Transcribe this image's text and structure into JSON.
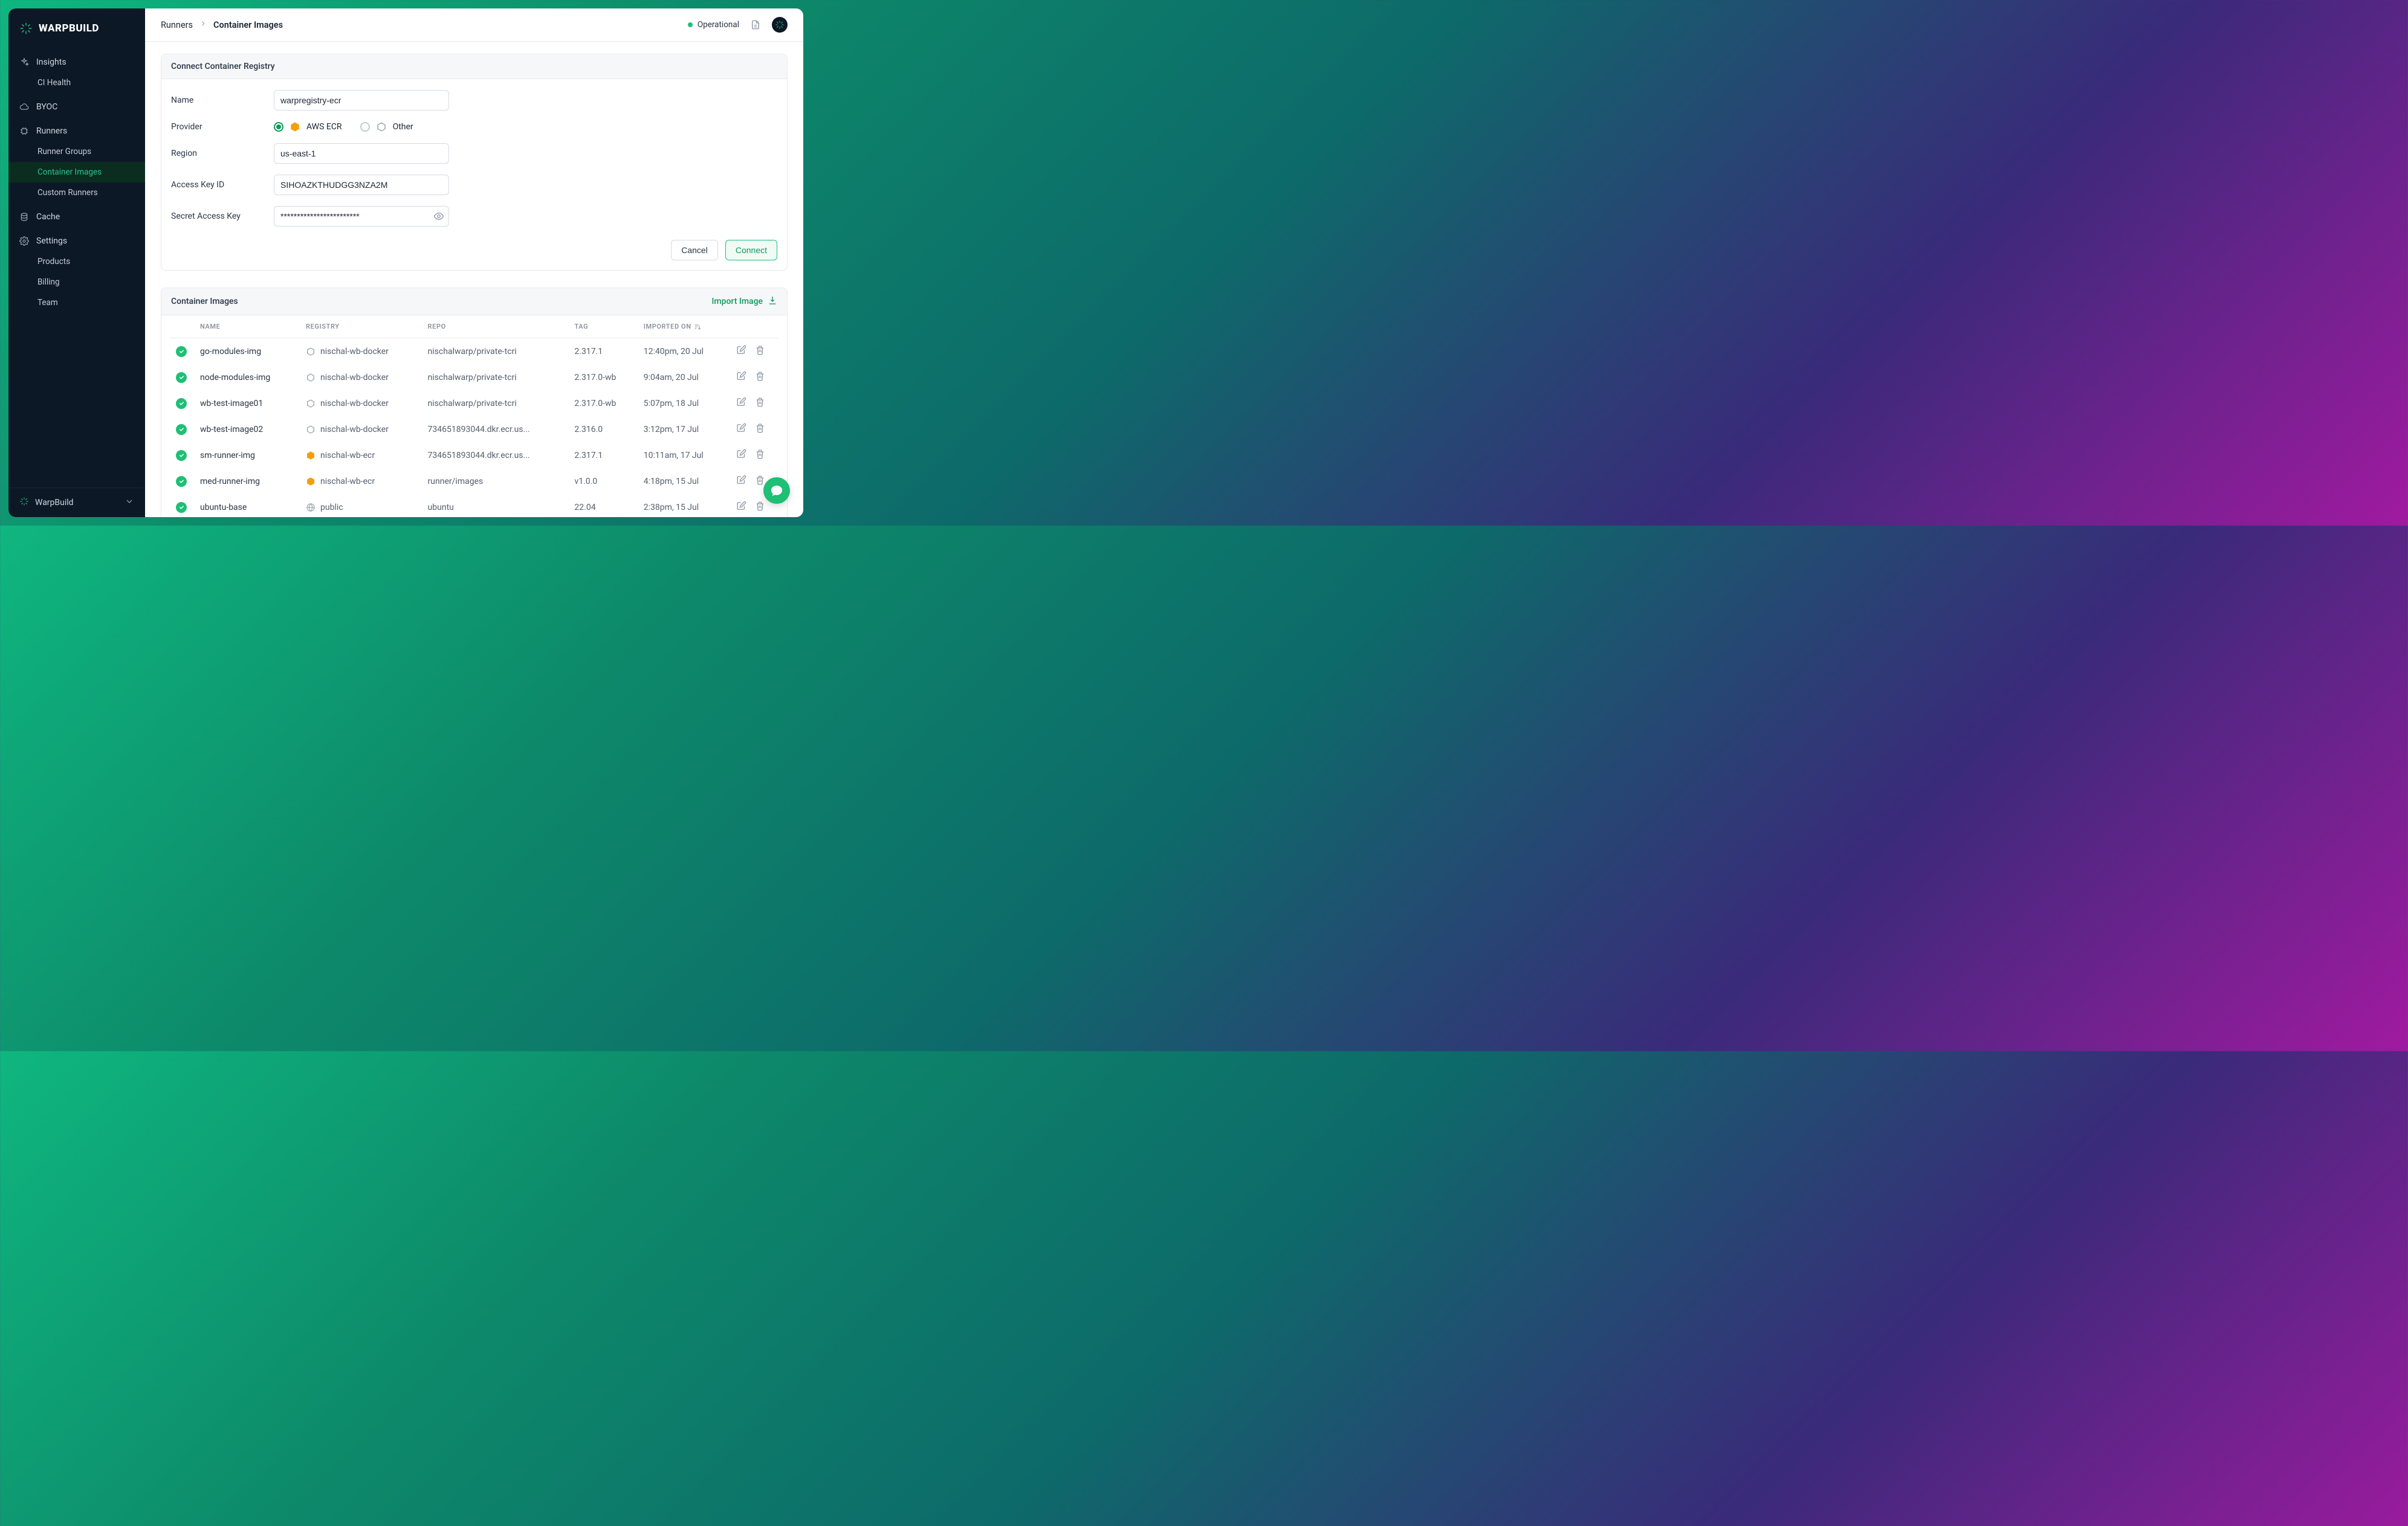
{
  "brand": {
    "name": "WARPBUILD",
    "footer_org": "WarpBuild"
  },
  "sidebar": {
    "items": [
      {
        "label": "Insights",
        "icon": "sparkle-icon",
        "children": [
          {
            "label": "CI Health"
          }
        ]
      },
      {
        "label": "BYOC",
        "icon": "cloud-icon"
      },
      {
        "label": "Runners",
        "icon": "chip-icon",
        "children": [
          {
            "label": "Runner Groups"
          },
          {
            "label": "Container Images",
            "active": true
          },
          {
            "label": "Custom Runners"
          }
        ]
      },
      {
        "label": "Cache",
        "icon": "database-icon"
      },
      {
        "label": "Settings",
        "icon": "gear-icon",
        "children": [
          {
            "label": "Products"
          },
          {
            "label": "Billing"
          },
          {
            "label": "Team"
          }
        ]
      }
    ]
  },
  "breadcrumb": {
    "root": "Runners",
    "current": "Container Images"
  },
  "status": {
    "label": "Operational"
  },
  "form": {
    "title": "Connect Container Registry",
    "labels": {
      "name": "Name",
      "provider": "Provider",
      "region": "Region",
      "access_key": "Access Key ID",
      "secret": "Secret Access Key"
    },
    "values": {
      "name": "warpregistry-ecr",
      "region": "us-east-1",
      "access_key": "SIHOAZKTHUDGG3NZA2M",
      "secret_mask": "************************"
    },
    "providers": {
      "aws": "AWS ECR",
      "other": "Other"
    },
    "buttons": {
      "cancel": "Cancel",
      "connect": "Connect"
    }
  },
  "images": {
    "title": "Container Images",
    "import_label": "Import Image",
    "columns": {
      "name": "NAME",
      "registry": "REGISTRY",
      "repo": "REPO",
      "tag": "TAG",
      "imported": "IMPORTED ON"
    },
    "rows": [
      {
        "name": "go-modules-img",
        "registry_kind": "docker",
        "registry": "nischal-wb-docker",
        "repo": "nischalwarp/private-tcri",
        "tag": "2.317.1",
        "imported": "12:40pm, 20 Jul"
      },
      {
        "name": "node-modules-img",
        "registry_kind": "docker",
        "registry": "nischal-wb-docker",
        "repo": "nischalwarp/private-tcri",
        "tag": "2.317.0-wb",
        "imported": "9:04am, 20 Jul"
      },
      {
        "name": "wb-test-image01",
        "registry_kind": "docker",
        "registry": "nischal-wb-docker",
        "repo": "nischalwarp/private-tcri",
        "tag": "2.317.0-wb",
        "imported": "5:07pm, 18 Jul"
      },
      {
        "name": "wb-test-image02",
        "registry_kind": "docker",
        "registry": "nischal-wb-docker",
        "repo": "734651893044.dkr.ecr.us...",
        "tag": "2.316.0",
        "imported": "3:12pm, 17 Jul"
      },
      {
        "name": "sm-runner-img",
        "registry_kind": "ecr",
        "registry": "nischal-wb-ecr",
        "repo": "734651893044.dkr.ecr.us...",
        "tag": "2.317.1",
        "imported": "10:11am, 17 Jul"
      },
      {
        "name": "med-runner-img",
        "registry_kind": "ecr",
        "registry": "nischal-wb-ecr",
        "repo": "runner/images",
        "tag": "v1.0.0",
        "imported": "4:18pm, 15 Jul"
      },
      {
        "name": "ubuntu-base",
        "registry_kind": "public",
        "registry": "public",
        "repo": "ubuntu",
        "tag": "22.04",
        "imported": "2:38pm, 15 Jul"
      }
    ]
  }
}
